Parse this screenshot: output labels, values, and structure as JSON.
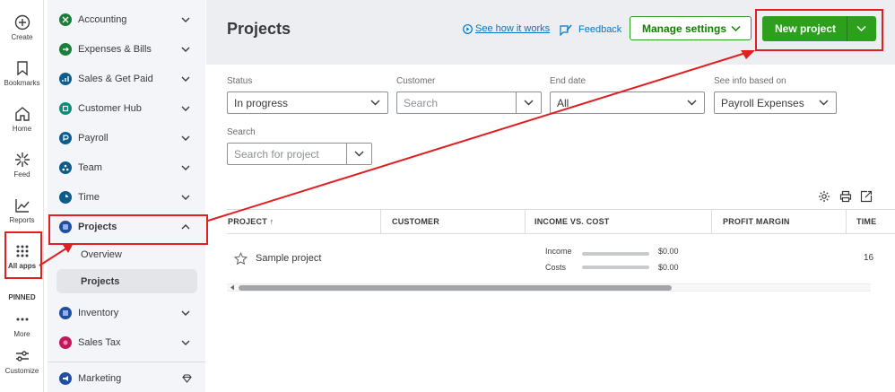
{
  "rail": {
    "items": [
      {
        "label": "Create",
        "icon": "plus-circle-icon"
      },
      {
        "label": "Bookmarks",
        "icon": "bookmark-icon"
      },
      {
        "label": "Home",
        "icon": "home-icon"
      },
      {
        "label": "Feed",
        "icon": "feed-sparkle-icon"
      },
      {
        "label": "Reports",
        "icon": "line-chart-icon"
      },
      {
        "label": "All apps",
        "icon": "grid-dots-icon"
      },
      {
        "label": "More",
        "icon": "more-dots-icon"
      },
      {
        "label": "Customize",
        "icon": "sliders-icon"
      }
    ],
    "pinned_label": "PINNED"
  },
  "sidebar": {
    "items": [
      {
        "label": "Accounting",
        "color": "#1b7f3b"
      },
      {
        "label": "Expenses & Bills",
        "color": "#1b7f3b"
      },
      {
        "label": "Sales & Get Paid",
        "color": "#0d5c8c"
      },
      {
        "label": "Customer Hub",
        "color": "#0e8c7a"
      },
      {
        "label": "Payroll",
        "color": "#0d5c8c"
      },
      {
        "label": "Team",
        "color": "#0d5c8c"
      },
      {
        "label": "Time",
        "color": "#0d5c8c"
      },
      {
        "label": "Projects",
        "color": "#1f4f9e"
      },
      {
        "label": "Inventory",
        "color": "#1f4f9e"
      },
      {
        "label": "Sales Tax",
        "color": "#c2185b"
      },
      {
        "label": "Marketing",
        "color": "#1f4f9e"
      }
    ],
    "sub_items": [
      "Overview",
      "Projects"
    ]
  },
  "header": {
    "title": "Projects",
    "how_link": "See how it works",
    "feedback_link": "Feedback",
    "manage_settings": "Manage settings",
    "new_project": "New project"
  },
  "filters": {
    "status_label": "Status",
    "status_value": "In progress",
    "customer_label": "Customer",
    "customer_placeholder": "Search",
    "end_date_label": "End date",
    "end_date_value": "All",
    "info_label": "See info based on",
    "info_value": "Payroll Expenses",
    "search_label": "Search",
    "search_placeholder": "Search for project"
  },
  "table": {
    "columns": [
      "PROJECT ↑",
      "CUSTOMER",
      "INCOME VS. COST",
      "PROFIT MARGIN",
      "TIME"
    ],
    "rows": [
      {
        "project": "Sample project",
        "income_label": "Income",
        "income_value": "$0.00",
        "costs_label": "Costs",
        "costs_value": "$0.00",
        "time": "16"
      }
    ]
  },
  "colors": {
    "brand_green": "#2ca01c",
    "highlight_red": "#e02020",
    "link_blue": "#0077c5"
  }
}
